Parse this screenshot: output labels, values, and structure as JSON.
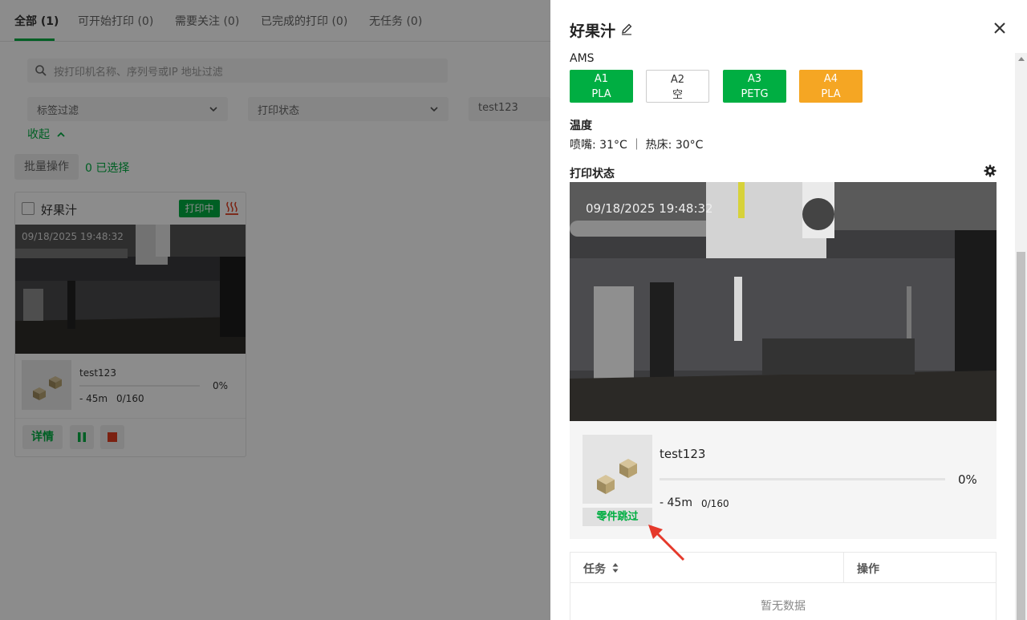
{
  "tabs": [
    {
      "label": "全部 (1)"
    },
    {
      "label": "可开始打印 (0)"
    },
    {
      "label": "需要关注 (0)"
    },
    {
      "label": "已完成的打印 (0)"
    },
    {
      "label": "无任务 (0)"
    }
  ],
  "filters": {
    "search_placeholder": "按打印机名称、序列号或IP 地址过滤",
    "tag_filter": "标签过滤",
    "print_status": "打印状态",
    "job_filter": "test123",
    "collapse": "收起"
  },
  "batch": {
    "label": "批量操作",
    "selected": "0 已选择"
  },
  "card": {
    "name": "好果汁",
    "status": "打印中",
    "timestamp": "09/18/2025 19:48:32",
    "job": "test123",
    "percent": "0%",
    "time_left": "- 45m",
    "layers": "0/160",
    "detail": "详情"
  },
  "drawer": {
    "title": "好果汁",
    "ams_label": "AMS",
    "ams_slots": [
      {
        "id": "A1",
        "material": "PLA",
        "color": "#00ae42"
      },
      {
        "id": "A2",
        "material": "空",
        "color": "#ffffff"
      },
      {
        "id": "A3",
        "material": "PETG",
        "color": "#00ae42"
      },
      {
        "id": "A4",
        "material": "PLA",
        "color": "#f5a623"
      }
    ],
    "temp_label": "温度",
    "temp_value": "喷嘴: 31°C ｜ 热床: 30°C",
    "print_status_label": "打印状态",
    "camera_timestamp": "09/18/2025 19:48:32",
    "job": "test123",
    "percent": "0%",
    "progress": 0,
    "time_left": "- 45m",
    "layers": "0/160",
    "skip_parts": "零件跳过",
    "table": {
      "col_task": "任务",
      "col_ops": "操作",
      "empty": "暂无数据"
    }
  },
  "colors": {
    "accent": "#00ae42",
    "warning": "#f5a623",
    "stop": "#e03c1f"
  }
}
